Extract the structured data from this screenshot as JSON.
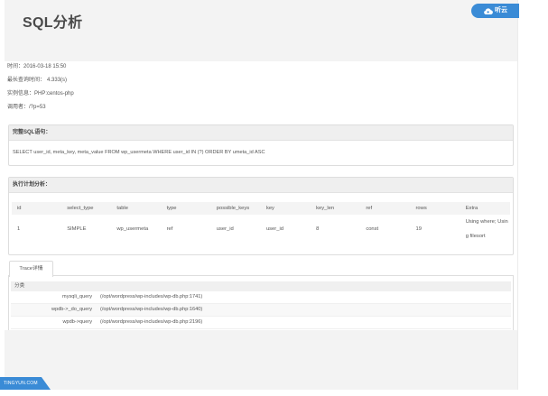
{
  "header": {
    "title": "SQL分析",
    "logo": {
      "icon": "cloud-icon",
      "text": "听云"
    }
  },
  "info": {
    "time": {
      "label": "时间：",
      "value": "2016-03-18 15:50"
    },
    "max_query_time": {
      "label": "最长查询时间：",
      "value": "4.333(s)"
    },
    "instance": {
      "label": "实例信息：",
      "value": "PHP:centos-php"
    },
    "caller": {
      "label": "调用者：",
      "value": "/?p=53"
    }
  },
  "sql_section": {
    "title": "完整SQL语句：",
    "statement": "SELECT user_id, meta_key, meta_value FROM wp_usermeta WHERE user_id IN (?) ORDER BY umeta_id ASC"
  },
  "explain_section": {
    "title": "执行计划分析：",
    "columns": [
      "id",
      "select_type",
      "table",
      "type",
      "possible_keys",
      "key",
      "key_len",
      "ref",
      "rows",
      "Extra"
    ],
    "rows": [
      {
        "id": "1",
        "select_type": "SIMPLE",
        "table": "wp_usermeta",
        "type": "ref",
        "possible_keys": "user_id",
        "key": "user_id",
        "key_len": "8",
        "ref": "const",
        "rows": "19",
        "extra": "Using where; Using filesort"
      }
    ]
  },
  "trace": {
    "tab_label": "Trace详情",
    "category_header": "分类",
    "rows": [
      {
        "function": "mysqli_query",
        "location": "(/opt/wordpress/wp-includes/wp-db.php:1741)"
      },
      {
        "function": "wpdb->_do_query",
        "location": "(/opt/wordpress/wp-includes/wp-db.php:1640)"
      },
      {
        "function": "wpdb->query",
        "location": "(/opt/wordpress/wp-includes/wp-db.php:2196)"
      }
    ]
  },
  "footer": {
    "brand": "TINGYUN.COM"
  },
  "colors": {
    "brand_blue": "#3a8bd6",
    "band_gray": "#f3f3f3",
    "border": "#dddddd",
    "header_gray": "#efefef",
    "text": "#555555"
  }
}
